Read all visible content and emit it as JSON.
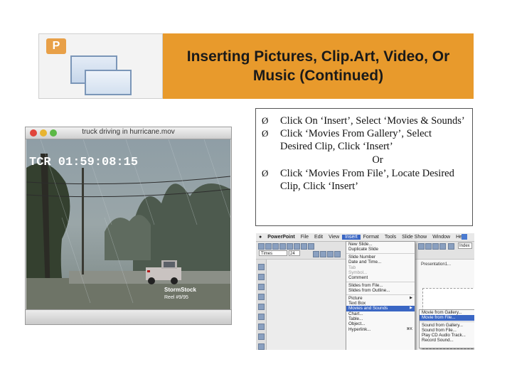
{
  "header": {
    "logo_glyph": "P",
    "title": "Inserting Pictures, Clip.Art, Video, Or Music (Continued)",
    "accent_color": "#e89a2c"
  },
  "bullets": {
    "items": [
      "Click On ‘Insert’, Select ‘Movies & Sounds’",
      "Click ‘Movies From Gallery’, Select Desired Clip, Click ‘Insert’"
    ],
    "or_text": "Or",
    "last_item": "Click ‘Movies From File’, Locate Desired Clip, Click ‘Insert’",
    "bullet_glyph": "Ø"
  },
  "video_window": {
    "title": "truck driving in hurricane.mov",
    "timecode": "TCR 01:59:08:15",
    "watermark_line1": "StormStock",
    "watermark_line2": "Reel #9/95",
    "traffic_colors": [
      "#e0443a",
      "#e8b430",
      "#5cb845"
    ]
  },
  "ppt": {
    "menubar": [
      "PowerPoint",
      "File",
      "Edit",
      "View",
      "Insert",
      "Format",
      "Tools",
      "Slide Show",
      "Window",
      "Help"
    ],
    "active_menu_index": 4,
    "font_value": "Times",
    "size_value": "24",
    "zoom_value": "Index",
    "doc_label": "Presentation1...",
    "insert_menu": [
      {
        "label": "New Slide...",
        "state": "normal"
      },
      {
        "label": "Duplicate Slide",
        "state": "normal"
      },
      {
        "sep": true
      },
      {
        "label": "Slide Number",
        "state": "normal"
      },
      {
        "label": "Date and Time...",
        "state": "normal"
      },
      {
        "label": "Tab",
        "state": "dim"
      },
      {
        "label": "Symbol...",
        "state": "dim"
      },
      {
        "label": "Comment",
        "state": "normal"
      },
      {
        "sep": true
      },
      {
        "label": "Slides from File...",
        "state": "normal"
      },
      {
        "label": "Slides from Outline...",
        "state": "normal"
      },
      {
        "sep": true
      },
      {
        "label": "Picture",
        "state": "normal",
        "submenu": true
      },
      {
        "label": "Text Box",
        "state": "normal"
      },
      {
        "label": "Movies and Sounds",
        "state": "highlight",
        "submenu": true
      },
      {
        "label": "Chart...",
        "state": "normal"
      },
      {
        "label": "Table...",
        "state": "normal"
      },
      {
        "label": "Object...",
        "state": "normal"
      },
      {
        "label": "Hyperlink...",
        "state": "normal",
        "shortcut": "⌘K"
      }
    ],
    "movies_submenu": [
      {
        "label": "Movie from Gallery...",
        "state": "normal"
      },
      {
        "label": "Movie from File...",
        "state": "highlight"
      },
      {
        "sep": true
      },
      {
        "label": "Sound from Gallery...",
        "state": "normal"
      },
      {
        "label": "Sound from File...",
        "state": "normal"
      },
      {
        "label": "Play CD Audio Track...",
        "state": "normal"
      },
      {
        "label": "Record Sound...",
        "state": "normal"
      }
    ]
  }
}
